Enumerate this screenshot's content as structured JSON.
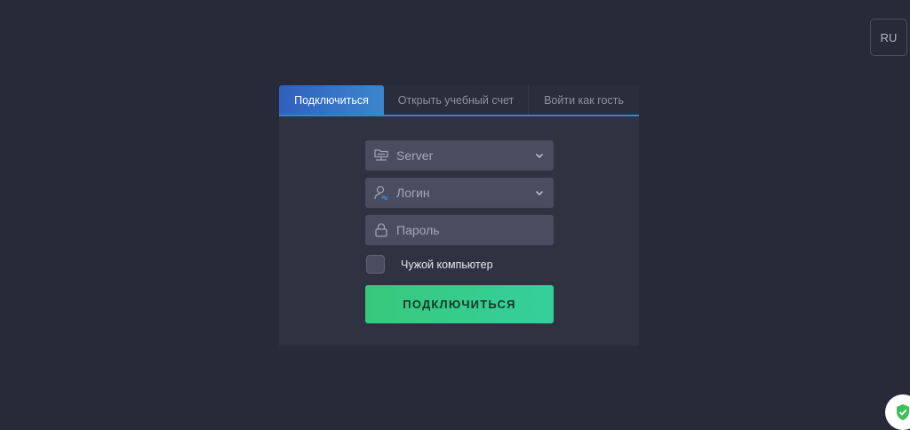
{
  "lang": {
    "label": "RU"
  },
  "tabs": [
    {
      "label": "Подключиться",
      "active": true
    },
    {
      "label": "Открыть учебный счет",
      "active": false
    },
    {
      "label": "Войти как гость",
      "active": false
    }
  ],
  "form": {
    "server": {
      "placeholder": "Server",
      "icon": "server-icon"
    },
    "login": {
      "placeholder": "Логин",
      "icon": "user-icon"
    },
    "password": {
      "placeholder": "Пароль",
      "icon": "lock-icon"
    },
    "remember_label": "Чужой компьютер",
    "submit_label": "ПОДКЛЮЧИТЬСЯ"
  },
  "colors": {
    "background": "#262a39",
    "panel": "#2f3241",
    "accent_blue": "#2f89c5",
    "submit_green": "#37c97a",
    "shield_green": "#3fbf5a"
  }
}
